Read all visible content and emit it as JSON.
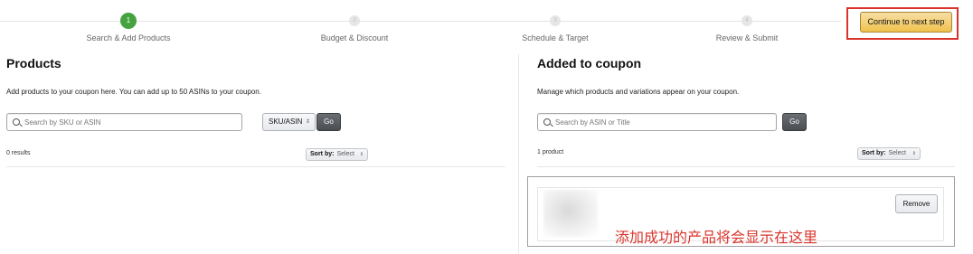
{
  "stepper": {
    "steps": [
      {
        "number": "1",
        "label": "Search & Add Products",
        "state": "active"
      },
      {
        "number": "2",
        "label": "Budget & Discount",
        "state": "inactive"
      },
      {
        "number": "3",
        "label": "Schedule & Target",
        "state": "inactive"
      },
      {
        "number": "4",
        "label": "Review & Submit",
        "state": "inactive"
      }
    ],
    "continue_label": "Continue to next step"
  },
  "products_panel": {
    "title": "Products",
    "description": "Add products to your coupon here. You can add up to 50 ASINs to your coupon.",
    "search_placeholder": "Search by SKU or ASIN",
    "search_value": "",
    "search_type": "SKU/ASIN",
    "go_label": "Go",
    "results_text": "0 results",
    "sort_label": "Sort by:",
    "sort_value": "Select"
  },
  "coupon_panel": {
    "title": "Added to coupon",
    "description": "Manage which products and variations appear on your coupon.",
    "search_placeholder": "Search by ASIN or Title",
    "search_value": "",
    "go_label": "Go",
    "results_text": "1 product",
    "sort_label": "Sort by:",
    "sort_value": "Select",
    "products": [
      {
        "remove_label": "Remove"
      }
    ],
    "annotation": "添加成功的产品将会显示在这里"
  },
  "colors": {
    "accent_green": "#45a33f",
    "highlight_red": "#d9342b",
    "button_gold": "#f0c14b"
  }
}
